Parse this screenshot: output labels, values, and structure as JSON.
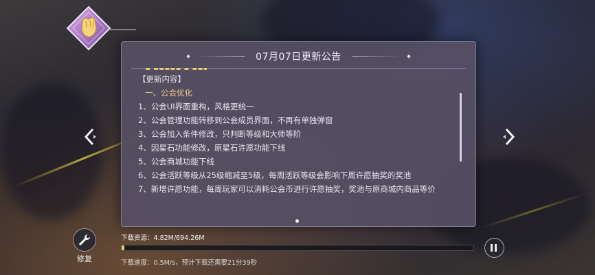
{
  "announcement": {
    "title": "07月07日更新公告",
    "lines": [
      {
        "text": "【更新内容】",
        "type": "normal"
      },
      {
        "text": "一、公会优化",
        "type": "heading"
      },
      {
        "text": "1、公会UI界面重构，风格更统一",
        "type": "normal"
      },
      {
        "text": "2、公会管理功能转移到公会成员界面，不再有单独弹窗",
        "type": "normal"
      },
      {
        "text": "3、公会加入条件修改，只判断等级和大师等阶",
        "type": "normal"
      },
      {
        "text": "4、因星石功能修改，原星石许愿功能下线",
        "type": "normal"
      },
      {
        "text": "5、公会商城功能下线",
        "type": "normal"
      },
      {
        "text": "6、公会活跃等级从25级缩减至5级，每周活跃等级会影响下周许愿抽奖的奖池",
        "type": "normal"
      },
      {
        "text": "7、新增许愿功能，每周玩家可以消耗公会币进行许愿抽奖，奖池与原商城内商品等价",
        "type": "normal"
      }
    ],
    "scroll_position": 0.35
  },
  "download": {
    "resource_label": "下载资源：4.82M/694.26M",
    "speed_label": "下载速度：0.5M/s，预计下载还需要21分39秒",
    "progress": 0.0069
  },
  "repair": {
    "label": "修复"
  },
  "icons": {
    "emblem": "fist-emblem-icon",
    "left": "chevron-left-icon",
    "right": "chevron-right-icon",
    "repair": "wrench-icon",
    "pause": "pause-icon"
  },
  "colors": {
    "accent": "#e9c882",
    "heading": "#f0c98c",
    "panel": "#565064"
  }
}
